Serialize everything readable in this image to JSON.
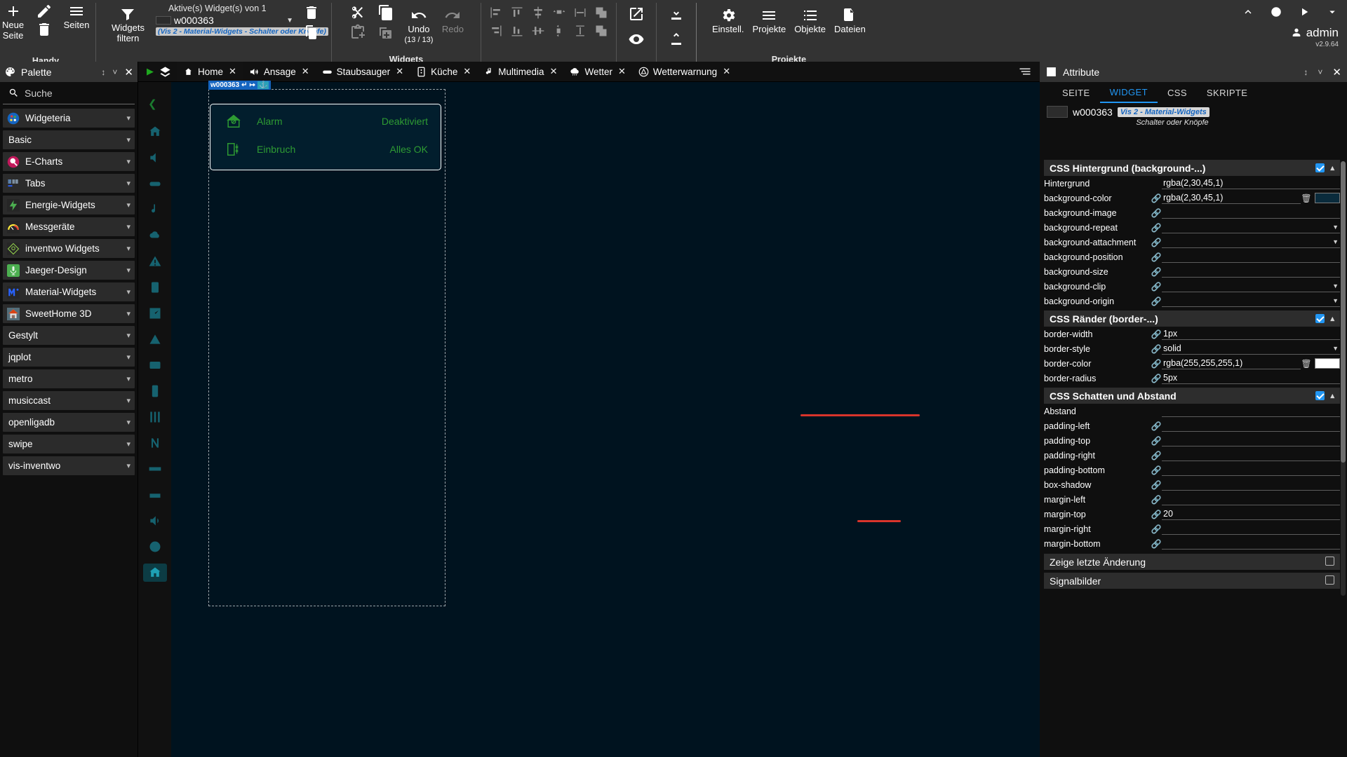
{
  "toolbar": {
    "groups": [
      {
        "label": "Handy",
        "buttons": [
          {
            "name": "new-page",
            "label": "Neue\nSeite",
            "icon": "plus-icon"
          },
          {
            "name": "edit-page",
            "label": "",
            "icon": "pencil-icon"
          },
          {
            "name": "delete-page",
            "label": "",
            "icon": "trash-icon"
          },
          {
            "name": "pages",
            "label": "Seiten",
            "icon": "hamburger-icon"
          }
        ]
      }
    ],
    "new_page_line1": "Neue",
    "new_page_line2": "Seite",
    "pages_label": "Seiten",
    "handy_label": "Handy",
    "filter_widgets_line1": "Widgets",
    "filter_widgets_line2": "filtern",
    "active_widgets_label": "Aktive(s) Widget(s) von 1",
    "selected_widget_id": "w000363",
    "selected_widget_set": "(Vis 2 - Material-Widgets - Schalter oder Knöpfe)",
    "undo_label": "Undo",
    "undo_count": "(13 / 13)",
    "redo_label": "Redo",
    "widgets_group_label": "Widgets",
    "projects_group_label": "Projekte",
    "settings_label": "Einstell.",
    "projects_label": "Projekte",
    "objects_label": "Objekte",
    "files_label": "Dateien",
    "username": "admin",
    "version": "v2.9.64"
  },
  "palette": {
    "title": "Palette",
    "search_placeholder": "Suche",
    "search_value": "",
    "items": [
      {
        "label": "Widgeteria",
        "icon": "widgeteria-icon",
        "color": "#1565c0",
        "has_icon": true,
        "chevron": "⌄"
      },
      {
        "label": "Basic",
        "icon": "",
        "color": "",
        "has_icon": false,
        "chevron": "⌄"
      },
      {
        "label": "E-Charts",
        "icon": "echarts-icon",
        "color": "#c2185b",
        "has_icon": true,
        "chevron": "⌄"
      },
      {
        "label": "Tabs",
        "icon": "tabs-icon",
        "color": "#3b5b80",
        "has_icon": true,
        "chevron": "⌄"
      },
      {
        "label": "Energie-Widgets",
        "icon": "energy-icon",
        "color": "#1f1f1f",
        "has_icon": true,
        "chevron": "⌄"
      },
      {
        "label": "Messgeräte",
        "icon": "gauge-icon",
        "color": "#1f1f1f",
        "has_icon": true,
        "chevron": "⌄"
      },
      {
        "label": "inventwo Widgets",
        "icon": "inventwo-icon",
        "color": "#1f1f1f",
        "has_icon": true,
        "chevron": "⌄"
      },
      {
        "label": "Jaeger-Design",
        "icon": "jaeger-icon",
        "color": "#4caf50",
        "has_icon": true,
        "chevron": "⌄"
      },
      {
        "label": "Material-Widgets",
        "icon": "material-icon",
        "color": "#1f1f1f",
        "has_icon": true,
        "chevron": "⌄"
      },
      {
        "label": "SweetHome 3D",
        "icon": "sweethome-icon",
        "color": "#607d8b",
        "has_icon": true,
        "chevron": "⌄"
      },
      {
        "label": "Gestylt",
        "icon": "",
        "color": "",
        "has_icon": false,
        "chevron": "⌄"
      },
      {
        "label": "jqplot",
        "icon": "",
        "color": "",
        "has_icon": false,
        "chevron": "⌄"
      },
      {
        "label": "metro",
        "icon": "",
        "color": "",
        "has_icon": false,
        "chevron": "⌄"
      },
      {
        "label": "musiccast",
        "icon": "",
        "color": "",
        "has_icon": false,
        "chevron": "⌄"
      },
      {
        "label": "openligadb",
        "icon": "",
        "color": "",
        "has_icon": false,
        "chevron": "⌄"
      },
      {
        "label": "swipe",
        "icon": "",
        "color": "",
        "has_icon": false,
        "chevron": "⌄"
      },
      {
        "label": "vis-inventwo",
        "icon": "",
        "color": "",
        "has_icon": false,
        "chevron": "⌄"
      }
    ]
  },
  "tabs": [
    {
      "label": "Home",
      "icon": "home-icon",
      "active": true
    },
    {
      "label": "Ansage",
      "icon": "speaker-icon",
      "active": false
    },
    {
      "label": "Staubsauger",
      "icon": "vacuum-icon",
      "active": false
    },
    {
      "label": "Küche",
      "icon": "kitchen-icon",
      "active": false
    },
    {
      "label": "Multimedia",
      "icon": "music-note-icon",
      "active": false
    },
    {
      "label": "Wetter",
      "icon": "cloud-rain-icon",
      "active": false
    },
    {
      "label": "Wetterwarnung",
      "icon": "warning-icon",
      "active": false
    }
  ],
  "canvas": {
    "widget_badge_id": "w000363",
    "rows": [
      {
        "icon": "house-shield-icon",
        "name": "Alarm",
        "value": "Deaktiviert"
      },
      {
        "icon": "door-sensor-icon",
        "name": "Einbruch",
        "value": "Alles OK"
      }
    ],
    "accent": "#2e9b33",
    "card_bg": "rgba(2,30,45,1)"
  },
  "attributes": {
    "title": "Attribute",
    "tabs": [
      {
        "label": "SEITE",
        "active": false
      },
      {
        "label": "WIDGET",
        "active": true
      },
      {
        "label": "CSS",
        "active": false
      },
      {
        "label": "SKRIPTE",
        "active": false
      }
    ],
    "widget_id": "w000363",
    "widget_set_badge": "Vis 2 - Material-Widgets",
    "widget_subtitle": "Schalter oder Knöpfe",
    "sections": [
      {
        "title": "CSS Hintergrund (background-...)",
        "checked": true,
        "rows": [
          {
            "label": "Hintergrund",
            "value": "rgba(2,30,45,1)",
            "link": false,
            "type": "text",
            "trash": false,
            "swatch": null,
            "select": false
          },
          {
            "label": "background-color",
            "value": "rgba(2,30,45,1)",
            "link": true,
            "type": "text",
            "trash": true,
            "swatch": "#0a2b3c",
            "select": false
          },
          {
            "label": "background-image",
            "value": "",
            "link": true,
            "type": "text",
            "trash": false,
            "swatch": null,
            "select": false
          },
          {
            "label": "background-repeat",
            "value": "",
            "link": true,
            "type": "select",
            "trash": false,
            "swatch": null,
            "select": true
          },
          {
            "label": "background-attachment",
            "value": "",
            "link": true,
            "type": "select",
            "trash": false,
            "swatch": null,
            "select": true
          },
          {
            "label": "background-position",
            "value": "",
            "link": true,
            "type": "text",
            "trash": false,
            "swatch": null,
            "select": false
          },
          {
            "label": "background-size",
            "value": "",
            "link": true,
            "type": "text",
            "trash": false,
            "swatch": null,
            "select": false
          },
          {
            "label": "background-clip",
            "value": "",
            "link": true,
            "type": "select",
            "trash": false,
            "swatch": null,
            "select": true
          },
          {
            "label": "background-origin",
            "value": "",
            "link": true,
            "type": "select",
            "trash": false,
            "swatch": null,
            "select": true
          }
        ]
      },
      {
        "title": "CSS Ränder (border-...)",
        "checked": true,
        "rows": [
          {
            "label": "border-width",
            "value": "1px",
            "link": true,
            "type": "text",
            "trash": false,
            "swatch": null,
            "select": false
          },
          {
            "label": "border-style",
            "value": "solid",
            "link": true,
            "type": "select",
            "trash": false,
            "swatch": null,
            "select": true
          },
          {
            "label": "border-color",
            "value": "rgba(255,255,255,1)",
            "link": true,
            "type": "text",
            "trash": true,
            "swatch": "#ffffff",
            "select": false
          },
          {
            "label": "border-radius",
            "value": "5px",
            "link": true,
            "type": "text",
            "trash": false,
            "swatch": null,
            "select": false
          }
        ]
      },
      {
        "title": "CSS Schatten und Abstand",
        "checked": true,
        "rows": [
          {
            "label": "Abstand",
            "value": "",
            "link": false,
            "type": "text",
            "trash": false,
            "swatch": null,
            "select": false
          },
          {
            "label": "padding-left",
            "value": "",
            "link": true,
            "type": "text",
            "trash": false,
            "swatch": null,
            "select": false
          },
          {
            "label": "padding-top",
            "value": "",
            "link": true,
            "type": "text",
            "trash": false,
            "swatch": null,
            "select": false
          },
          {
            "label": "padding-right",
            "value": "",
            "link": true,
            "type": "text",
            "trash": false,
            "swatch": null,
            "select": false
          },
          {
            "label": "padding-bottom",
            "value": "",
            "link": true,
            "type": "text",
            "trash": false,
            "swatch": null,
            "select": false
          },
          {
            "label": "box-shadow",
            "value": "",
            "link": true,
            "type": "text",
            "trash": false,
            "swatch": null,
            "select": false
          },
          {
            "label": "margin-left",
            "value": "",
            "link": true,
            "type": "text",
            "trash": false,
            "swatch": null,
            "select": false
          },
          {
            "label": "margin-top",
            "value": "20",
            "link": true,
            "type": "text",
            "trash": false,
            "swatch": null,
            "select": false
          },
          {
            "label": "margin-right",
            "value": "",
            "link": true,
            "type": "text",
            "trash": false,
            "swatch": null,
            "select": false
          },
          {
            "label": "margin-bottom",
            "value": "",
            "link": true,
            "type": "text",
            "trash": false,
            "swatch": null,
            "select": false
          }
        ]
      }
    ],
    "footers": [
      {
        "label": "Zeige letzte Änderung",
        "checked": false
      },
      {
        "label": "Signalbilder",
        "checked": false
      }
    ],
    "annotation_color": "#d9342b"
  }
}
